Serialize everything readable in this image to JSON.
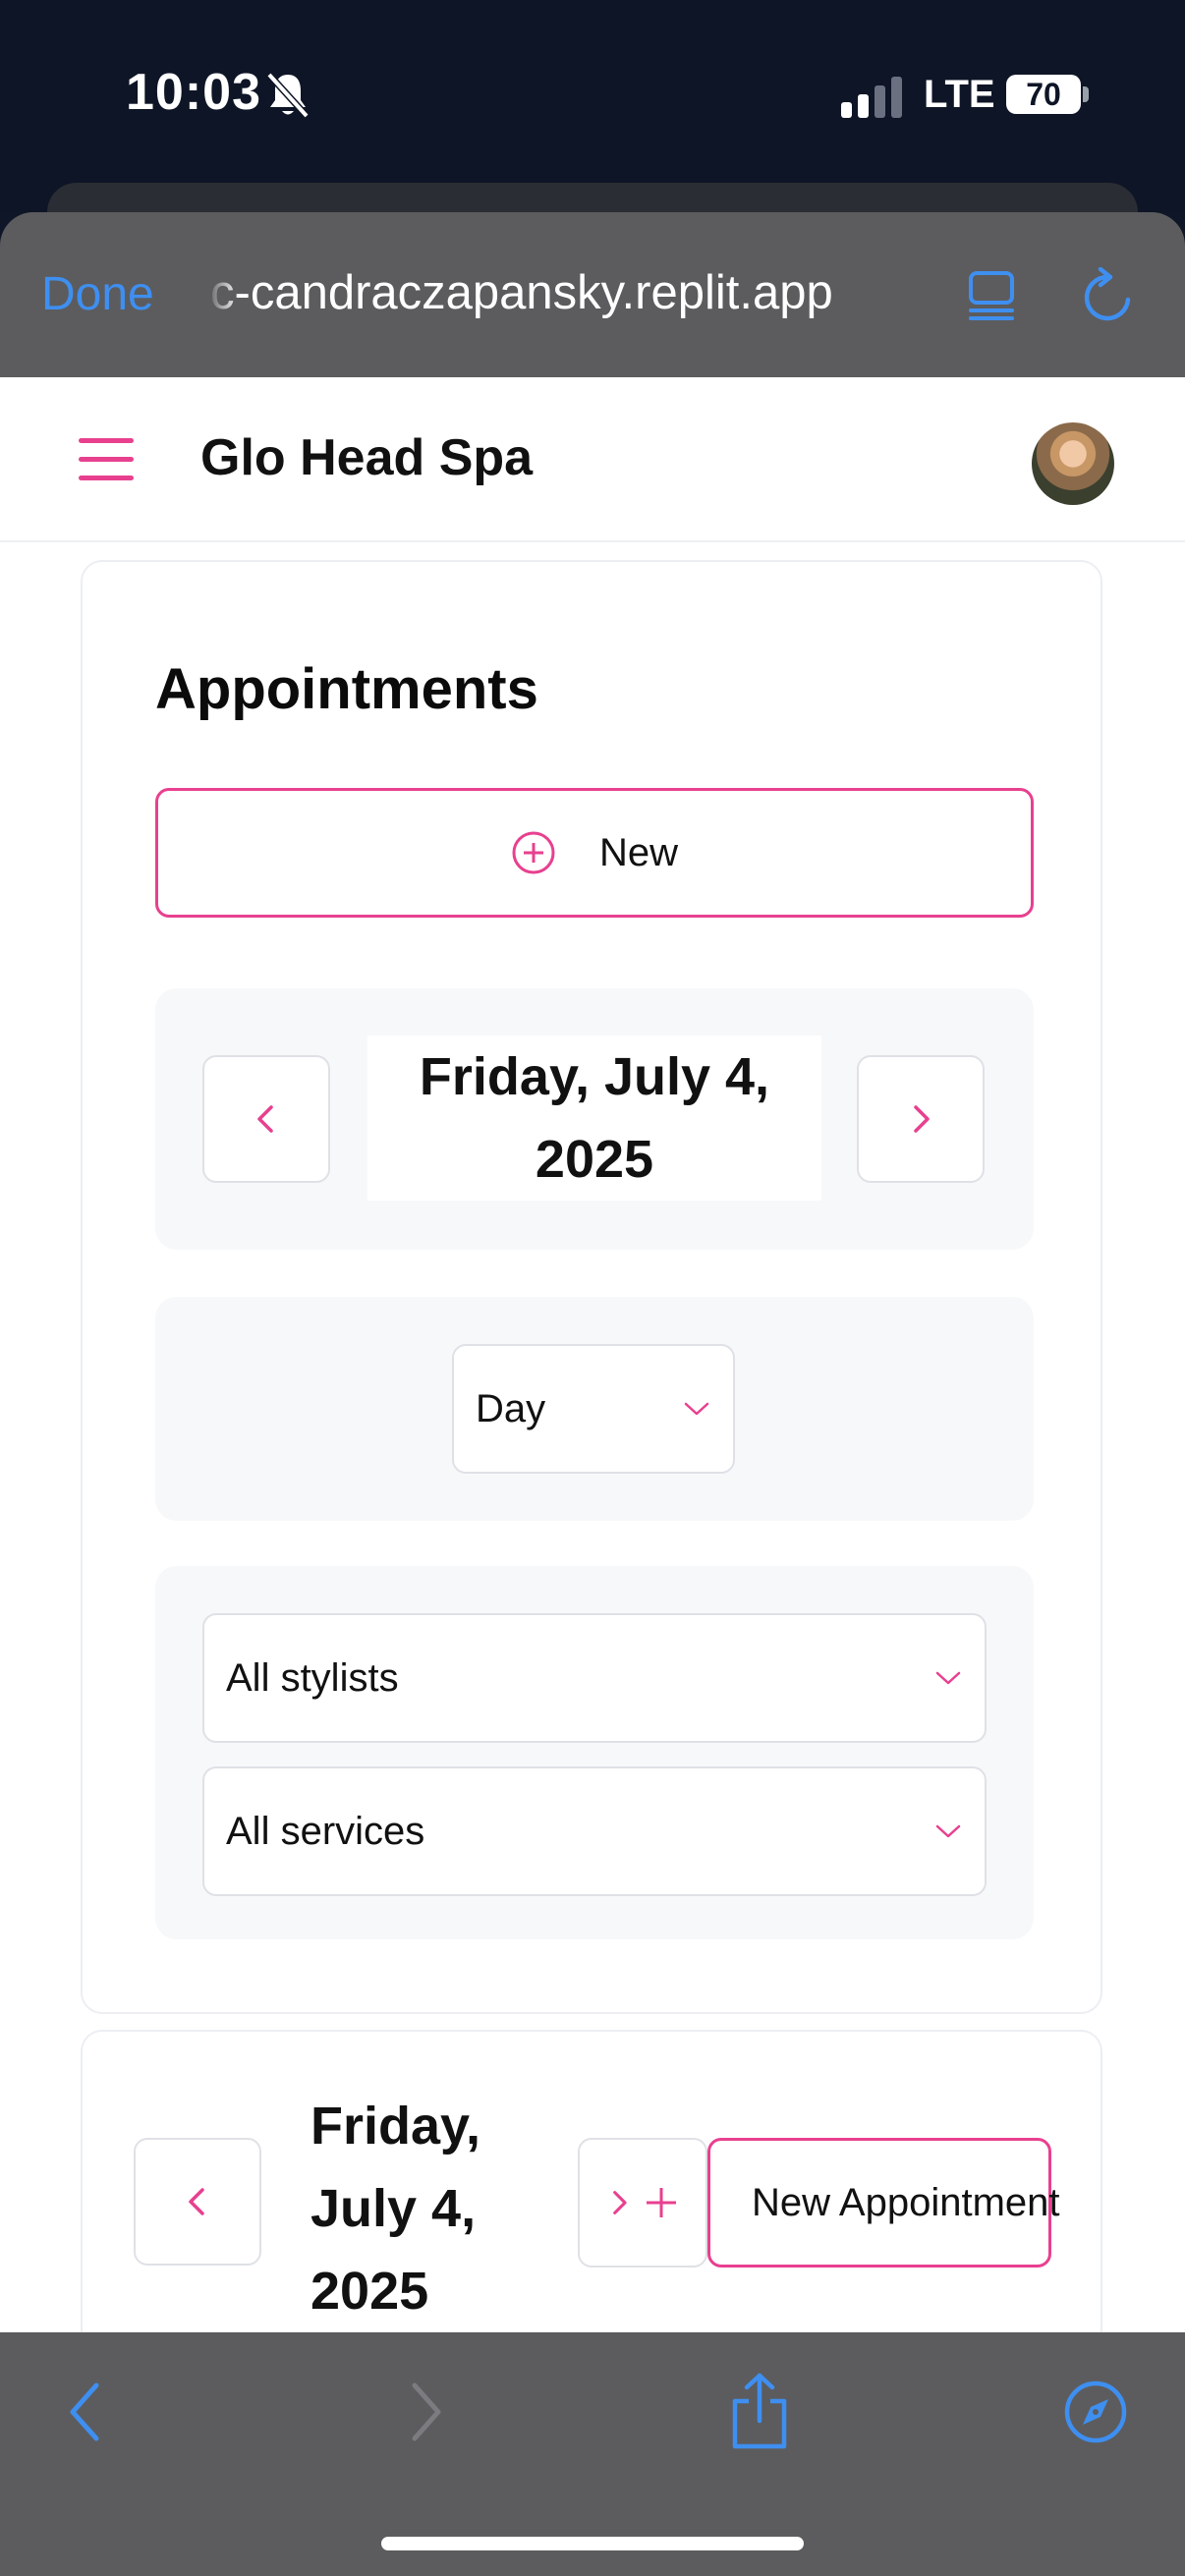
{
  "status_bar": {
    "time": "10:03",
    "network": "LTE",
    "battery": "70"
  },
  "browser": {
    "done_label": "Done",
    "url": "c-candraczapansky.replit.app"
  },
  "app": {
    "brand": "Glo Head Spa",
    "accent_color": "#e8408f"
  },
  "appointments": {
    "title": "Appointments",
    "new_button_label": "New",
    "date_label": "Friday, July 4, 2025",
    "view_select": "Day",
    "stylist_filter": "All stylists",
    "service_filter": "All services"
  },
  "calendar_header": {
    "date_lines": [
      "Friday,",
      "July 4,",
      "2025"
    ],
    "new_appointment_label": "New Appointment"
  }
}
